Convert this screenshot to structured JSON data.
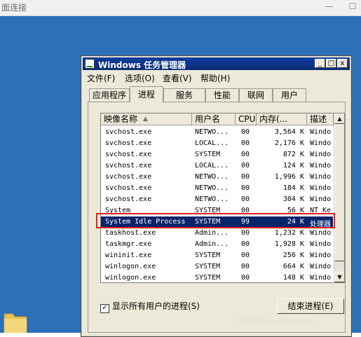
{
  "remote": {
    "title": "面连接",
    "minimize_glyph": "—",
    "restore_glyph": "☐"
  },
  "window": {
    "title": "Windows 任务管理器",
    "min_glyph": "_",
    "max_glyph": "□",
    "close_glyph": "x"
  },
  "menu": [
    {
      "label": "文件(F)"
    },
    {
      "label": "选项(O)"
    },
    {
      "label": "查看(V)"
    },
    {
      "label": "帮助(H)"
    }
  ],
  "tabs": [
    {
      "label": "应用程序"
    },
    {
      "label": "进程",
      "active": true
    },
    {
      "label": "服务"
    },
    {
      "label": "性能"
    },
    {
      "label": "联网"
    },
    {
      "label": "用户"
    }
  ],
  "columns": [
    "映像名称",
    "用户名",
    "CPU",
    "内存(...",
    "描述"
  ],
  "rows": [
    {
      "name": "svchost.exe",
      "user": "NETWO...",
      "cpu": "00",
      "mem": "3,564 K",
      "desc": "Windo"
    },
    {
      "name": "svchost.exe",
      "user": "LOCAL...",
      "cpu": "00",
      "mem": "2,176 K",
      "desc": "Windo"
    },
    {
      "name": "svchost.exe",
      "user": "SYSTEM",
      "cpu": "00",
      "mem": "872 K",
      "desc": "Windo"
    },
    {
      "name": "svchost.exe",
      "user": "LOCAL...",
      "cpu": "00",
      "mem": "124 K",
      "desc": "Windo"
    },
    {
      "name": "svchost.exe",
      "user": "NETWO...",
      "cpu": "00",
      "mem": "1,996 K",
      "desc": "Windo"
    },
    {
      "name": "svchost.exe",
      "user": "NETWO...",
      "cpu": "00",
      "mem": "184 K",
      "desc": "Windo"
    },
    {
      "name": "svchost.exe",
      "user": "NETWO...",
      "cpu": "00",
      "mem": "304 K",
      "desc": "Windo"
    },
    {
      "name": "System",
      "user": "SYSTEM",
      "cpu": "00",
      "mem": "56 K",
      "desc": "NT Ke"
    },
    {
      "name": "System Idle Process",
      "user": "SYSTEM",
      "cpu": "99",
      "mem": "24 K",
      "desc": "处理器",
      "selected": true
    },
    {
      "name": "taskhost.exe",
      "user": "Admin...",
      "cpu": "00",
      "mem": "1,232 K",
      "desc": "Windo"
    },
    {
      "name": "taskmgr.exe",
      "user": "Admin...",
      "cpu": "00",
      "mem": "1,928 K",
      "desc": "Windo"
    },
    {
      "name": "wininit.exe",
      "user": "SYSTEM",
      "cpu": "00",
      "mem": "256 K",
      "desc": "Windo"
    },
    {
      "name": "winlogon.exe",
      "user": "SYSTEM",
      "cpu": "00",
      "mem": "664 K",
      "desc": "Windo"
    },
    {
      "name": "winlogon.exe",
      "user": "SYSTEM",
      "cpu": "00",
      "mem": "148 K",
      "desc": "Windo"
    }
  ],
  "show_all_users": {
    "label": "显示所有用户的进程(S)",
    "checked": true,
    "mark": "✓"
  },
  "end_process_label": "结束进程(E)",
  "watermark": "云栖社区 yq.aliyun.com",
  "colors": {
    "selection": "#0a246a",
    "highlight": "#e02020",
    "desktop": "#2c70b8",
    "titlebar": "#0a2b76"
  }
}
